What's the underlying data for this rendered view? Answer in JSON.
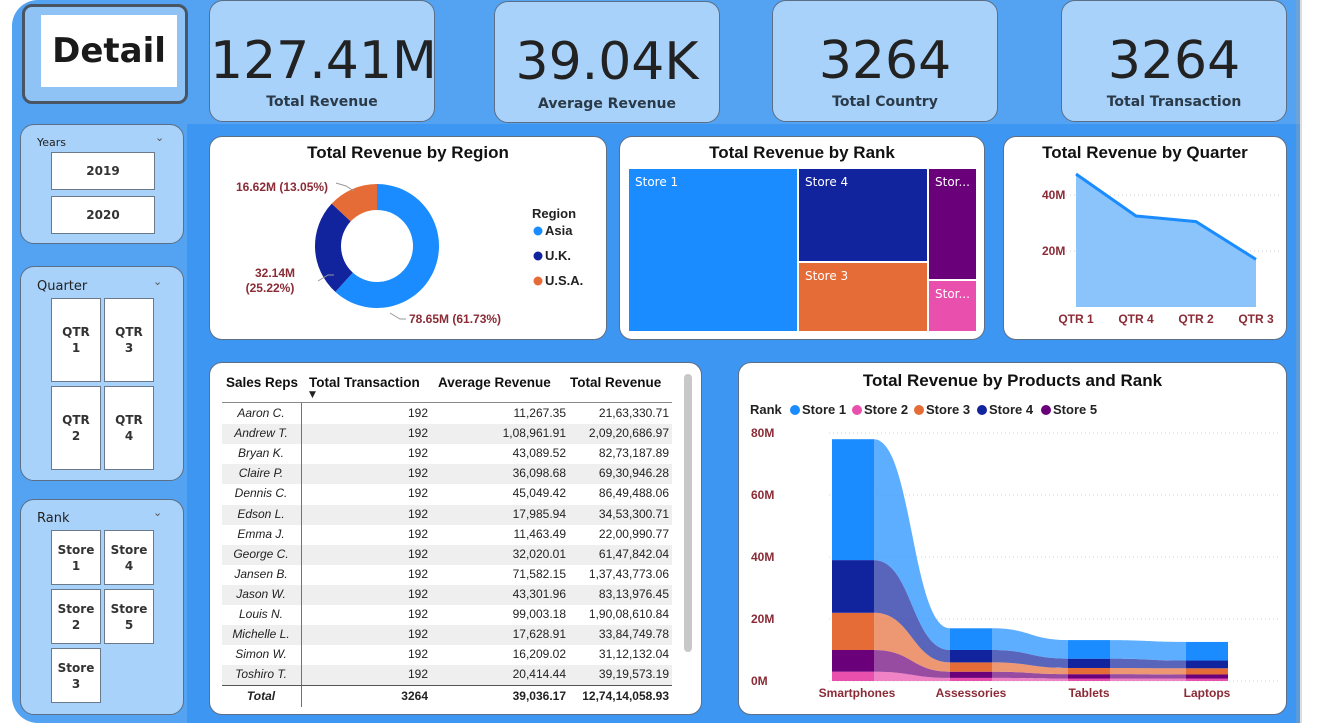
{
  "detail_button": "Detail",
  "kpis": [
    {
      "value": "127.41M",
      "label": "Total Revenue"
    },
    {
      "value": "39.04K",
      "label": "Average Revenue"
    },
    {
      "value": "3264",
      "label": "Total Country"
    },
    {
      "value": "3264",
      "label": "Total Transaction"
    }
  ],
  "slicers": {
    "years": {
      "title": "Years",
      "options": [
        "2019",
        "2020"
      ]
    },
    "quarter": {
      "title": "Quarter",
      "options": [
        "QTR\n1",
        "QTR\n3",
        "QTR\n2",
        "QTR\n4"
      ]
    },
    "rank": {
      "title": "Rank",
      "options": [
        "Store\n1",
        "Store\n4",
        "Store\n2",
        "Store\n5",
        "Store\n3"
      ]
    }
  },
  "colors": {
    "store1": "#1a8cff",
    "store2": "#e94fad",
    "store3": "#e66c37",
    "store4": "#12239e",
    "store5": "#6b007b",
    "axis_label": "#8a2b36"
  },
  "region_chart": {
    "title": "Total Revenue by Region",
    "legend_title": "Region",
    "chart_data": {
      "type": "pie",
      "categories": [
        "Asia",
        "U.K.",
        "U.S.A."
      ],
      "values": [
        78.65,
        32.14,
        16.62
      ],
      "labels": [
        "78.65M (61.73%)",
        "32.14M\n(25.22%)",
        "16.62M (13.05%)"
      ]
    }
  },
  "rank_chart": {
    "title": "Total Revenue by Rank",
    "chart_data": {
      "type": "treemap",
      "tiles": [
        {
          "label": "Store 1",
          "color": "#1a8cff"
        },
        {
          "label": "Store 4",
          "color": "#12239e"
        },
        {
          "label": "Stor...",
          "color": "#6b007b"
        },
        {
          "label": "Store 3",
          "color": "#e66c37"
        },
        {
          "label": "Stor...",
          "color": "#e94fad"
        }
      ]
    }
  },
  "quarter_chart": {
    "title": "Total Revenue by Quarter",
    "chart_data": {
      "type": "area",
      "categories": [
        "QTR 1",
        "QTR 4",
        "QTR 2",
        "QTR 3"
      ],
      "values": [
        47.5,
        32.5,
        30.5,
        17.0
      ],
      "yticks": [
        "20M",
        "40M"
      ],
      "ylim": [
        0,
        50
      ]
    }
  },
  "sales_table": {
    "headers": [
      "Sales Reps",
      "Total Transaction",
      "Average Revenue",
      "Total Revenue"
    ],
    "rows": [
      [
        "Aaron C.",
        "192",
        "11,267.35",
        "21,63,330.71"
      ],
      [
        "Andrew T.",
        "192",
        "1,08,961.91",
        "2,09,20,686.97"
      ],
      [
        "Bryan K.",
        "192",
        "43,089.52",
        "82,73,187.89"
      ],
      [
        "Claire P.",
        "192",
        "36,098.68",
        "69,30,946.28"
      ],
      [
        "Dennis C.",
        "192",
        "45,049.42",
        "86,49,488.06"
      ],
      [
        "Edson L.",
        "192",
        "17,985.94",
        "34,53,300.71"
      ],
      [
        "Emma J.",
        "192",
        "11,463.49",
        "22,00,990.77"
      ],
      [
        "George C.",
        "192",
        "32,020.01",
        "61,47,842.04"
      ],
      [
        "Jansen B.",
        "192",
        "71,582.15",
        "1,37,43,773.06"
      ],
      [
        "Jason W.",
        "192",
        "43,301.96",
        "83,13,976.45"
      ],
      [
        "Louis N.",
        "192",
        "99,003.18",
        "1,90,08,610.84"
      ],
      [
        "Michelle L.",
        "192",
        "17,628.91",
        "33,84,749.78"
      ],
      [
        "Simon W.",
        "192",
        "16,209.02",
        "31,12,132.04"
      ],
      [
        "Toshiro T.",
        "192",
        "20,414.44",
        "39,19,573.19"
      ]
    ],
    "total": [
      "Total",
      "3264",
      "39,036.17",
      "12,74,14,058.93"
    ]
  },
  "products_chart": {
    "title": "Total Revenue by Products and Rank",
    "legend_title": "Rank",
    "chart_data": {
      "type": "bar",
      "stacked": true,
      "categories": [
        "Smartphones",
        "Assessories",
        "Tablets",
        "Laptops"
      ],
      "series": [
        {
          "name": "Store 1",
          "values": [
            39.0,
            7.0,
            6.0,
            6.0
          ]
        },
        {
          "name": "Store 2",
          "values": [
            3.0,
            1.0,
            0.8,
            0.8
          ]
        },
        {
          "name": "Store 3",
          "values": [
            12.0,
            3.0,
            2.0,
            2.0
          ]
        },
        {
          "name": "Store 4",
          "values": [
            17.0,
            4.0,
            3.0,
            2.5
          ]
        },
        {
          "name": "Store 5",
          "values": [
            7.0,
            2.0,
            1.4,
            1.3
          ]
        }
      ],
      "yticks": [
        "0M",
        "20M",
        "40M",
        "60M",
        "80M"
      ],
      "ylim": [
        0,
        80
      ]
    }
  }
}
